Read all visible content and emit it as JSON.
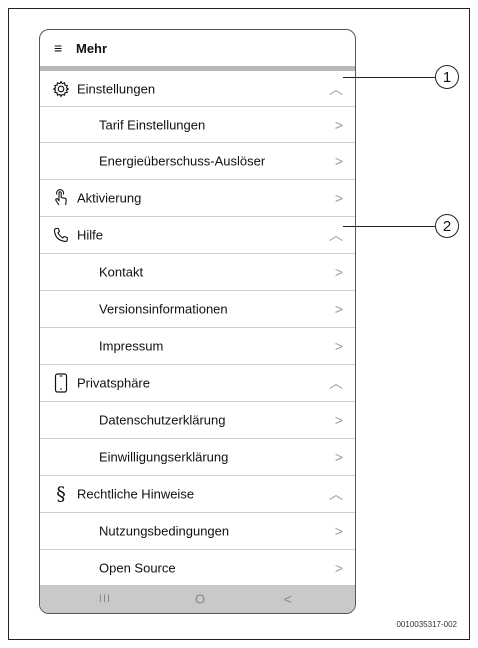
{
  "header": {
    "menu_glyph": "≡",
    "title": "Mehr"
  },
  "items": [
    {
      "label": "Einstellungen",
      "icon": "gear-icon",
      "chevron": "up"
    },
    {
      "label": "Tarif Einstellungen",
      "chevron": "right"
    },
    {
      "label": "Energieüberschuss-Auslöser",
      "chevron": "right"
    },
    {
      "label": "Aktivierung",
      "icon": "touch-icon",
      "chevron": "right"
    },
    {
      "label": "Hilfe",
      "icon": "phone-icon",
      "chevron": "up"
    },
    {
      "label": "Kontakt",
      "chevron": "right"
    },
    {
      "label": "Versionsinformationen",
      "chevron": "right"
    },
    {
      "label": "Impressum",
      "chevron": "right"
    },
    {
      "label": "Privatsphäre",
      "icon": "smartphone-icon",
      "chevron": "up"
    },
    {
      "label": "Datenschutzerklärung",
      "chevron": "right"
    },
    {
      "label": "Einwilligungserklärung",
      "chevron": "right"
    },
    {
      "label": "Rechtliche Hinweise",
      "icon": "section-icon",
      "chevron": "up"
    },
    {
      "label": "Nutzungsbedingungen",
      "chevron": "right"
    },
    {
      "label": "Open Source",
      "chevron": "right"
    }
  ],
  "navbar": {
    "recent_glyph": "III",
    "home_glyph": "O",
    "back_glyph": "<"
  },
  "callouts": [
    "1",
    "2"
  ],
  "reference_code": "0010035317-002"
}
